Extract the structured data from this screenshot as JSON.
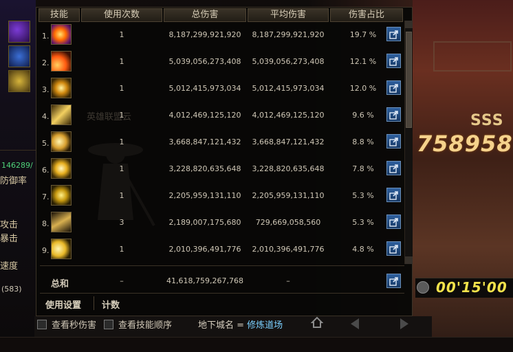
{
  "panel": {
    "headers": [
      "技能",
      "使用次数",
      "总伤害",
      "平均伤害",
      "伤害占比"
    ],
    "rows": [
      {
        "index": "1.",
        "icon": "explosion-skill-icon",
        "uses": "1",
        "total": "8,187,299,921,920",
        "avg": "8,187,299,921,920",
        "share": "19.7 %"
      },
      {
        "index": "2.",
        "icon": "flame-burst-skill-icon",
        "uses": "1",
        "total": "5,039,056,273,408",
        "avg": "5,039,056,273,408",
        "share": "12.1 %"
      },
      {
        "index": "3.",
        "icon": "whirl-slash-skill-icon",
        "uses": "1",
        "total": "5,012,415,973,034",
        "avg": "5,012,415,973,034",
        "share": "12.0 %"
      },
      {
        "index": "4.",
        "icon": "sword-strike-skill-icon",
        "uses": "1",
        "total": "4,012,469,125,120",
        "avg": "4,012,469,125,120",
        "share": "9.6 %"
      },
      {
        "index": "5.",
        "icon": "wave-slash-skill-icon",
        "uses": "1",
        "total": "3,668,847,121,432",
        "avg": "3,668,847,121,432",
        "share": "8.8 %"
      },
      {
        "index": "6.",
        "icon": "star-burst-skill-icon",
        "uses": "1",
        "total": "3,228,820,635,648",
        "avg": "3,228,820,635,648",
        "share": "7.8 %"
      },
      {
        "index": "7.",
        "icon": "crescent-skill-icon",
        "uses": "1",
        "total": "2,205,959,131,110",
        "avg": "2,205,959,131,110",
        "share": "5.3 %"
      },
      {
        "index": "8.",
        "icon": "blade-flow-skill-icon",
        "uses": "3",
        "total": "2,189,007,175,680",
        "avg": "729,669,058,560",
        "share": "5.3 %"
      },
      {
        "index": "9.",
        "icon": "triple-slash-skill-icon",
        "uses": "1",
        "total": "2,010,396,491,776",
        "avg": "2,010,396,491,776",
        "share": "4.8 %"
      }
    ],
    "total": {
      "label": "总和",
      "uses": "–",
      "total": "41,618,759,267,768",
      "avg": "–"
    },
    "footer_tabs": [
      "使用设置",
      "计数"
    ],
    "watermark_text": "英雄联盟云"
  },
  "below_window": {
    "checkbox_dps": "查看秒伤害",
    "checkbox_order": "查看技能顺序",
    "location_prefix": "地下城名 = ",
    "location_name": "修炼道场"
  },
  "game": {
    "rank": "SSS",
    "score": "758958",
    "timer": "00'15'00",
    "left_stat_number": "146289/",
    "left_labels": [
      "防御率",
      "攻击",
      "暴击",
      "速度"
    ],
    "left_stat_bottom": "(583)"
  },
  "colors": {
    "share_button": "#2e5f9e",
    "timer": "#f2e24b",
    "score": "#f5d28c",
    "header": "#3a3328"
  }
}
